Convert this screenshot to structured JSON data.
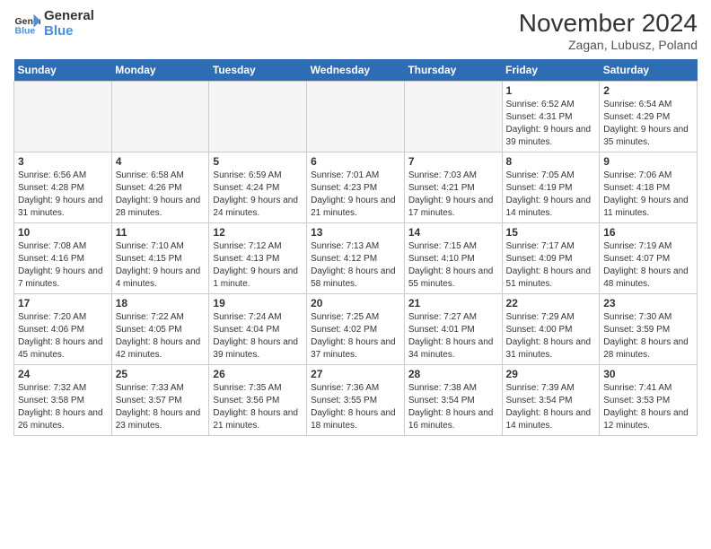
{
  "header": {
    "logo_line1": "General",
    "logo_line2": "Blue",
    "month_title": "November 2024",
    "location": "Zagan, Lubusz, Poland"
  },
  "days_of_week": [
    "Sunday",
    "Monday",
    "Tuesday",
    "Wednesday",
    "Thursday",
    "Friday",
    "Saturday"
  ],
  "weeks": [
    [
      {
        "day": "",
        "info": "",
        "empty": true
      },
      {
        "day": "",
        "info": "",
        "empty": true
      },
      {
        "day": "",
        "info": "",
        "empty": true
      },
      {
        "day": "",
        "info": "",
        "empty": true
      },
      {
        "day": "",
        "info": "",
        "empty": true
      },
      {
        "day": "1",
        "info": "Sunrise: 6:52 AM\nSunset: 4:31 PM\nDaylight: 9 hours and 39 minutes."
      },
      {
        "day": "2",
        "info": "Sunrise: 6:54 AM\nSunset: 4:29 PM\nDaylight: 9 hours and 35 minutes."
      }
    ],
    [
      {
        "day": "3",
        "info": "Sunrise: 6:56 AM\nSunset: 4:28 PM\nDaylight: 9 hours and 31 minutes."
      },
      {
        "day": "4",
        "info": "Sunrise: 6:58 AM\nSunset: 4:26 PM\nDaylight: 9 hours and 28 minutes."
      },
      {
        "day": "5",
        "info": "Sunrise: 6:59 AM\nSunset: 4:24 PM\nDaylight: 9 hours and 24 minutes."
      },
      {
        "day": "6",
        "info": "Sunrise: 7:01 AM\nSunset: 4:23 PM\nDaylight: 9 hours and 21 minutes."
      },
      {
        "day": "7",
        "info": "Sunrise: 7:03 AM\nSunset: 4:21 PM\nDaylight: 9 hours and 17 minutes."
      },
      {
        "day": "8",
        "info": "Sunrise: 7:05 AM\nSunset: 4:19 PM\nDaylight: 9 hours and 14 minutes."
      },
      {
        "day": "9",
        "info": "Sunrise: 7:06 AM\nSunset: 4:18 PM\nDaylight: 9 hours and 11 minutes."
      }
    ],
    [
      {
        "day": "10",
        "info": "Sunrise: 7:08 AM\nSunset: 4:16 PM\nDaylight: 9 hours and 7 minutes."
      },
      {
        "day": "11",
        "info": "Sunrise: 7:10 AM\nSunset: 4:15 PM\nDaylight: 9 hours and 4 minutes."
      },
      {
        "day": "12",
        "info": "Sunrise: 7:12 AM\nSunset: 4:13 PM\nDaylight: 9 hours and 1 minute."
      },
      {
        "day": "13",
        "info": "Sunrise: 7:13 AM\nSunset: 4:12 PM\nDaylight: 8 hours and 58 minutes."
      },
      {
        "day": "14",
        "info": "Sunrise: 7:15 AM\nSunset: 4:10 PM\nDaylight: 8 hours and 55 minutes."
      },
      {
        "day": "15",
        "info": "Sunrise: 7:17 AM\nSunset: 4:09 PM\nDaylight: 8 hours and 51 minutes."
      },
      {
        "day": "16",
        "info": "Sunrise: 7:19 AM\nSunset: 4:07 PM\nDaylight: 8 hours and 48 minutes."
      }
    ],
    [
      {
        "day": "17",
        "info": "Sunrise: 7:20 AM\nSunset: 4:06 PM\nDaylight: 8 hours and 45 minutes."
      },
      {
        "day": "18",
        "info": "Sunrise: 7:22 AM\nSunset: 4:05 PM\nDaylight: 8 hours and 42 minutes."
      },
      {
        "day": "19",
        "info": "Sunrise: 7:24 AM\nSunset: 4:04 PM\nDaylight: 8 hours and 39 minutes."
      },
      {
        "day": "20",
        "info": "Sunrise: 7:25 AM\nSunset: 4:02 PM\nDaylight: 8 hours and 37 minutes."
      },
      {
        "day": "21",
        "info": "Sunrise: 7:27 AM\nSunset: 4:01 PM\nDaylight: 8 hours and 34 minutes."
      },
      {
        "day": "22",
        "info": "Sunrise: 7:29 AM\nSunset: 4:00 PM\nDaylight: 8 hours and 31 minutes."
      },
      {
        "day": "23",
        "info": "Sunrise: 7:30 AM\nSunset: 3:59 PM\nDaylight: 8 hours and 28 minutes."
      }
    ],
    [
      {
        "day": "24",
        "info": "Sunrise: 7:32 AM\nSunset: 3:58 PM\nDaylight: 8 hours and 26 minutes."
      },
      {
        "day": "25",
        "info": "Sunrise: 7:33 AM\nSunset: 3:57 PM\nDaylight: 8 hours and 23 minutes."
      },
      {
        "day": "26",
        "info": "Sunrise: 7:35 AM\nSunset: 3:56 PM\nDaylight: 8 hours and 21 minutes."
      },
      {
        "day": "27",
        "info": "Sunrise: 7:36 AM\nSunset: 3:55 PM\nDaylight: 8 hours and 18 minutes."
      },
      {
        "day": "28",
        "info": "Sunrise: 7:38 AM\nSunset: 3:54 PM\nDaylight: 8 hours and 16 minutes."
      },
      {
        "day": "29",
        "info": "Sunrise: 7:39 AM\nSunset: 3:54 PM\nDaylight: 8 hours and 14 minutes."
      },
      {
        "day": "30",
        "info": "Sunrise: 7:41 AM\nSunset: 3:53 PM\nDaylight: 8 hours and 12 minutes."
      }
    ]
  ]
}
